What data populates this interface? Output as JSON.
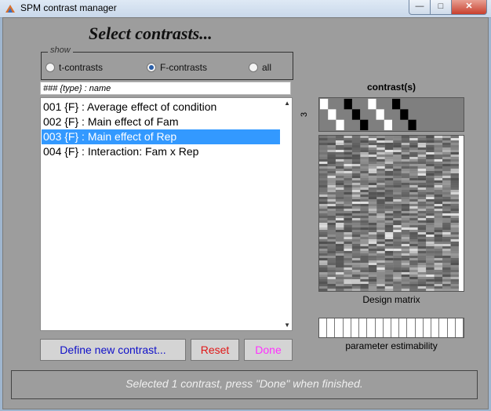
{
  "window": {
    "title": "SPM contrast manager",
    "close_glyph": "✕",
    "min_glyph": "—",
    "max_glyph": "□"
  },
  "heading": "Select contrasts...",
  "show": {
    "label": "show",
    "options": [
      {
        "label": "t-contrasts",
        "selected": false
      },
      {
        "label": "F-contrasts",
        "selected": true
      },
      {
        "label": "all",
        "selected": false
      }
    ]
  },
  "list": {
    "header": "### {type} : name",
    "items": [
      {
        "label": "001 {F} : Average effect of condition",
        "selected": false
      },
      {
        "label": "002 {F} : Main effect of Fam",
        "selected": false
      },
      {
        "label": "003 {F} : Main effect of Rep",
        "selected": true
      },
      {
        "label": "004 {F} : Interaction: Fam x Rep",
        "selected": false
      }
    ]
  },
  "buttons": {
    "define": "Define new contrast...",
    "reset": "Reset",
    "done": "Done",
    "define_color": "#1010c8",
    "reset_color": "#e01818",
    "done_color": "#ff30ff"
  },
  "contrast_panel": {
    "title": "contrast(s)",
    "rows_label": "3",
    "design_label": "Design matrix",
    "estimability_label": "parameter estimability"
  },
  "status": "Selected 1 contrast, press \"Done\" when finished."
}
